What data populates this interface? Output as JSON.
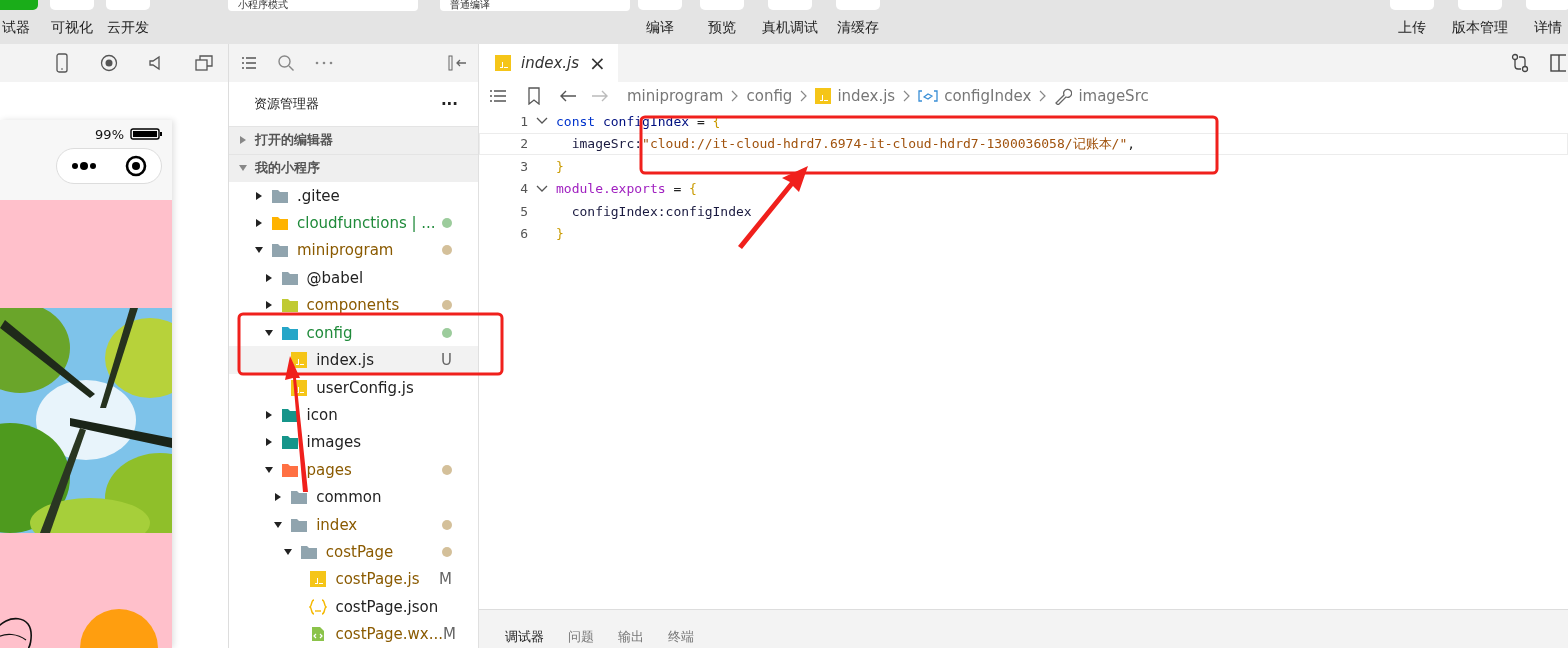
{
  "toolbar": {
    "left_buttons": [
      {
        "label": "试器"
      },
      {
        "label": "可视化"
      },
      {
        "label": "云开发"
      }
    ],
    "fields": [
      {
        "value": "小程序模式"
      },
      {
        "value": "普通编译"
      }
    ],
    "center_buttons": [
      {
        "label": "编译"
      },
      {
        "label": "预览"
      },
      {
        "label": "真机调试"
      },
      {
        "label": "清缓存"
      }
    ],
    "right_buttons": [
      {
        "label": "上传"
      },
      {
        "label": "版本管理"
      },
      {
        "label": "详情"
      }
    ]
  },
  "simulator": {
    "battery_text": "99%"
  },
  "explorer": {
    "title": "资源管理器",
    "more": "···",
    "sections": [
      {
        "label": "打开的编辑器",
        "expanded": false
      },
      {
        "label": "我的小程序",
        "expanded": true
      }
    ],
    "tree": [
      {
        "name": ".gitee",
        "kind": "folder",
        "color": "#90a4ae",
        "expanded": false,
        "untracked": false,
        "modified": false
      },
      {
        "name": "cloudfunctions | ...",
        "kind": "folder",
        "color": "#ffb300",
        "expanded": false,
        "untracked": true,
        "modified": false
      },
      {
        "name": "miniprogram",
        "kind": "folder",
        "color": "#90a4ae",
        "expanded": true,
        "untracked": false,
        "modified": true,
        "children": [
          {
            "name": "@babel",
            "kind": "folder",
            "color": "#90a4ae",
            "expanded": false,
            "untracked": false,
            "modified": false
          },
          {
            "name": "components",
            "kind": "folder",
            "color": "#c0ca33",
            "expanded": false,
            "untracked": false,
            "modified": true
          },
          {
            "name": "config",
            "kind": "folder",
            "color": "#26a6c8",
            "expanded": true,
            "untracked": true,
            "modified": false,
            "children": [
              {
                "name": "index.js",
                "kind": "js",
                "untracked": false,
                "modified": false,
                "badge": "U",
                "selected": true
              },
              {
                "name": "userConfig.js",
                "kind": "js",
                "untracked": false,
                "modified": false,
                "selected": false
              }
            ]
          },
          {
            "name": "icon",
            "kind": "folder",
            "color": "#16958a",
            "expanded": false,
            "untracked": false,
            "modified": false
          },
          {
            "name": "images",
            "kind": "folder",
            "color": "#16958a",
            "expanded": false,
            "untracked": false,
            "modified": false
          },
          {
            "name": "pages",
            "kind": "folder",
            "color": "#ff7043",
            "expanded": true,
            "untracked": false,
            "modified": true,
            "children": [
              {
                "name": "common",
                "kind": "folder",
                "color": "#90a4ae",
                "expanded": false,
                "untracked": false,
                "modified": false
              },
              {
                "name": "index",
                "kind": "folder",
                "color": "#90a4ae",
                "expanded": true,
                "untracked": false,
                "modified": true,
                "children": [
                  {
                    "name": "costPage",
                    "kind": "folder",
                    "color": "#90a4ae",
                    "expanded": true,
                    "untracked": false,
                    "modified": true,
                    "children": [
                      {
                        "name": "costPage.js",
                        "kind": "js",
                        "untracked": false,
                        "modified": true,
                        "badge": "M",
                        "selected": false
                      },
                      {
                        "name": "costPage.json",
                        "kind": "json",
                        "untracked": false,
                        "modified": false,
                        "selected": false
                      },
                      {
                        "name": "costPage.wx...",
                        "kind": "wxml",
                        "untracked": false,
                        "modified": true,
                        "badge": "M",
                        "selected": false
                      }
                    ]
                  }
                ]
              }
            ]
          }
        ]
      }
    ]
  },
  "editor": {
    "tabs": [
      {
        "label": "index.js",
        "selected": true,
        "close": "×"
      }
    ],
    "breadcrumb": [
      {
        "label": "miniprogram",
        "kind": "folder"
      },
      {
        "label": "config",
        "kind": "folder"
      },
      {
        "label": "index.js",
        "kind": "js"
      },
      {
        "label": "configIndex",
        "kind": "variable"
      },
      {
        "label": "imageSrc",
        "kind": "property"
      }
    ],
    "lines": [
      {
        "number": "1",
        "fold": true,
        "current": false,
        "tokens": [
          {
            "text": "const ",
            "kind": "keyword"
          },
          {
            "text": "configIndex",
            "kind": "variable"
          },
          {
            "text": " = ",
            "kind": "operator"
          },
          {
            "text": "{",
            "kind": "bracket"
          }
        ]
      },
      {
        "number": "2",
        "fold": false,
        "current": true,
        "tokens": [
          {
            "text": "  imageSrc:",
            "kind": "property"
          },
          {
            "text": "\"cloud://it-cloud-hdrd7.6974-it-cloud-hdrd7-1300036058/记账本/\"",
            "kind": "string"
          },
          {
            "text": ",",
            "kind": "operator"
          }
        ]
      },
      {
        "number": "3",
        "fold": false,
        "current": false,
        "tokens": [
          {
            "text": "}",
            "kind": "bracket"
          }
        ]
      },
      {
        "number": "4",
        "fold": true,
        "current": false,
        "tokens": [
          {
            "text": "module.exports",
            "kind": "module"
          },
          {
            "text": " = ",
            "kind": "operator"
          },
          {
            "text": "{",
            "kind": "bracket"
          }
        ]
      },
      {
        "number": "5",
        "fold": false,
        "current": false,
        "tokens": [
          {
            "text": "  configIndex:configIndex",
            "kind": "property"
          }
        ]
      },
      {
        "number": "6",
        "fold": false,
        "current": false,
        "tokens": [
          {
            "text": "}",
            "kind": "bracket"
          }
        ]
      }
    ]
  },
  "bottom_panel": {
    "tabs": [
      {
        "label": "调试器",
        "selected": true
      },
      {
        "label": "问题",
        "selected": false
      },
      {
        "label": "输出",
        "selected": false
      },
      {
        "label": "终端",
        "selected": false
      }
    ]
  }
}
